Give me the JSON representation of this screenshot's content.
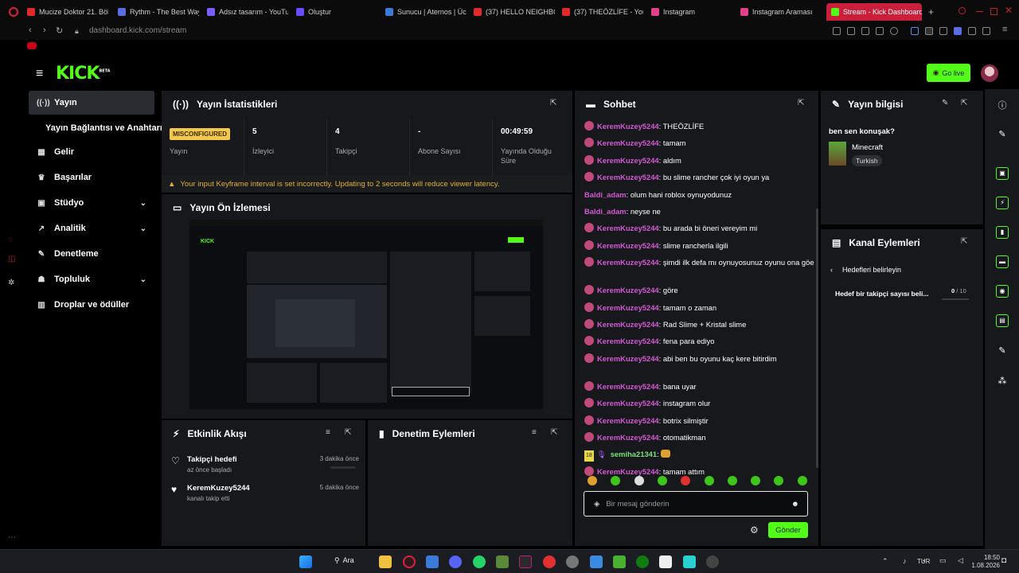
{
  "browser": {
    "tabs": [
      {
        "label": "Mucize Doktor 21. Bölü",
        "color": "#e02a2a"
      },
      {
        "label": "Rythm - The Best Way",
        "color": "#5b6ee1"
      },
      {
        "label": "Adsız tasarım - YouTub",
        "color": "#7a5cff"
      },
      {
        "label": "Oluştur",
        "color": "#6a4cff"
      },
      {
        "label": "Sunucu | Aternos | Üc",
        "color": "#3a7ad8"
      },
      {
        "label": "(37) HELLO NEIGHBOR",
        "color": "#e02a2a"
      },
      {
        "label": "(37) THEÖZLİFE - You",
        "color": "#e02a2a"
      },
      {
        "label": "Instagram",
        "color": "#e0408a"
      },
      {
        "label": "Instagram Araması",
        "color": "#e0408a"
      },
      {
        "label": "Stream - Kick Dashboard",
        "color": "#53fc18"
      }
    ],
    "new_tab": "+",
    "url": "dashboard.kick.com/stream"
  },
  "header": {
    "logo": "KICK",
    "logo_sup": "BETA",
    "go_live": "Go live"
  },
  "sidebar": {
    "items": [
      {
        "label": "Yayın",
        "icon": "broadcast-icon",
        "glyph": "((·))",
        "chevron": ""
      },
      {
        "label": "Yayın Bağlantısı ve Anahtarı",
        "icon": "",
        "glyph": "",
        "chevron": ""
      },
      {
        "label": "Gelir",
        "icon": "revenue-icon",
        "glyph": "▦",
        "chevron": ""
      },
      {
        "label": "Başarılar",
        "icon": "trophy-icon",
        "glyph": "♛",
        "chevron": ""
      },
      {
        "label": "Stüdyo",
        "icon": "studio-icon",
        "glyph": "▣",
        "chevron": "⌄"
      },
      {
        "label": "Analitik",
        "icon": "analytics-icon",
        "glyph": "↗",
        "chevron": "⌄"
      },
      {
        "label": "Denetleme",
        "icon": "moderation-icon",
        "glyph": "✎",
        "chevron": ""
      },
      {
        "label": "Topluluk",
        "icon": "community-icon",
        "glyph": "☗",
        "chevron": "⌄"
      },
      {
        "label": "Droplar ve ödüller",
        "icon": "drops-icon",
        "glyph": "▥",
        "chevron": ""
      }
    ]
  },
  "stats": {
    "title": "Yayın İstatistikleri",
    "badge": "MISCONFIGURED",
    "cells": [
      {
        "value": "",
        "label": "Yayın"
      },
      {
        "value": "5",
        "label": "İzleyici"
      },
      {
        "value": "4",
        "label": "Takipçi"
      },
      {
        "value": "-",
        "label": "Abone Sayısı"
      },
      {
        "value": "00:49:59",
        "label": "Yayında Olduğu Süre"
      }
    ],
    "warning": "Your input Keyframe interval is set incorrectly. Updating to 2 seconds will reduce viewer latency."
  },
  "preview": {
    "title": "Yayın Ön İzlemesi"
  },
  "activity": {
    "title": "Etkinlik Akışı",
    "rows": [
      {
        "title": "Takipçi hedefi",
        "sub": "az önce başladı",
        "time": "3 dakika önce"
      },
      {
        "title": "KeremKuzey5244",
        "sub": "kanalı takip etti",
        "time": "5 dakika önce"
      }
    ]
  },
  "moderation": {
    "title": "Denetim Eylemleri"
  },
  "chat": {
    "title": "Sohbet",
    "messages": [
      {
        "user": "KeremKuzey5244",
        "text": "THEÖZLİFE",
        "color": "#d459d4",
        "badge": true
      },
      {
        "user": "KeremKuzey5244",
        "text": "tamam",
        "color": "#d459d4",
        "badge": true
      },
      {
        "user": "KeremKuzey5244",
        "text": "aldım",
        "color": "#d459d4",
        "badge": true
      },
      {
        "user": "KeremKuzey5244",
        "text": "bu slime rancher çok iyi oyun ya",
        "color": "#d459d4",
        "badge": true
      },
      {
        "user": "Baldi_adam",
        "text": "olum hani roblox oynuyodunuz",
        "color": "#d459d4",
        "badge": false
      },
      {
        "user": "Baldi_adam",
        "text": "neyse ne",
        "color": "#d459d4",
        "badge": false
      },
      {
        "user": "KeremKuzey5244",
        "text": "bu arada bi öneri vereyim mi",
        "color": "#d459d4",
        "badge": true
      },
      {
        "user": "KeremKuzey5244",
        "text": "slime rancherla ilgili",
        "color": "#d459d4",
        "badge": true
      },
      {
        "user": "KeremKuzey5244",
        "text": "şimdi ilk defa mı oynuyosunuz oyunu ona göe",
        "color": "#d459d4",
        "badge": true
      },
      {
        "user": "KeremKuzey5244",
        "text": "göre",
        "color": "#d459d4",
        "badge": true
      },
      {
        "user": "KeremKuzey5244",
        "text": "tamam o zaman",
        "color": "#d459d4",
        "badge": true
      },
      {
        "user": "KeremKuzey5244",
        "text": "Rad Slime + Kristal slime",
        "color": "#d459d4",
        "badge": true
      },
      {
        "user": "KeremKuzey5244",
        "text": "fena para ediyo",
        "color": "#d459d4",
        "badge": true
      },
      {
        "user": "KeremKuzey5244",
        "text": "abi ben bu oyunu kaç kere bitirdim",
        "color": "#d459d4",
        "badge": true
      },
      {
        "user": "KeremKuzey5244",
        "text": "bana uyar",
        "color": "#d459d4",
        "badge": true
      },
      {
        "user": "KeremKuzey5244",
        "text": "instagram olur",
        "color": "#d459d4",
        "badge": true
      },
      {
        "user": "KeremKuzey5244",
        "text": "botrix silmiştir",
        "color": "#d459d4",
        "badge": true
      },
      {
        "user": "KeremKuzey5244",
        "text": "otomatikman",
        "color": "#d459d4",
        "badge": true
      },
      {
        "user": "semiha21341",
        "text": "",
        "color": "#7be07b",
        "badge": false,
        "age": "18"
      },
      {
        "user": "KeremKuzey5244",
        "text": "tamam attım",
        "color": "#d459d4",
        "badge": true
      }
    ],
    "placeholder": "Bir mesaj gönderin",
    "send": "Gönder"
  },
  "stream_info": {
    "title": "Yayın bilgisi",
    "stream_title": "ben sen konuşak?",
    "category": "Minecraft",
    "tag": "Turkish"
  },
  "channel_actions": {
    "title": "Kanal Eylemleri",
    "back": "Hedefleri belirleyin",
    "goal_label": "Hedef bir takipçi sayısı beli...",
    "goal_current": "0",
    "goal_total": "/ 10",
    "goal_progress": 0
  },
  "taskbar": {
    "search": "Ara",
    "lang": "TUR",
    "time": "18:50",
    "date": "1.08.2026"
  }
}
